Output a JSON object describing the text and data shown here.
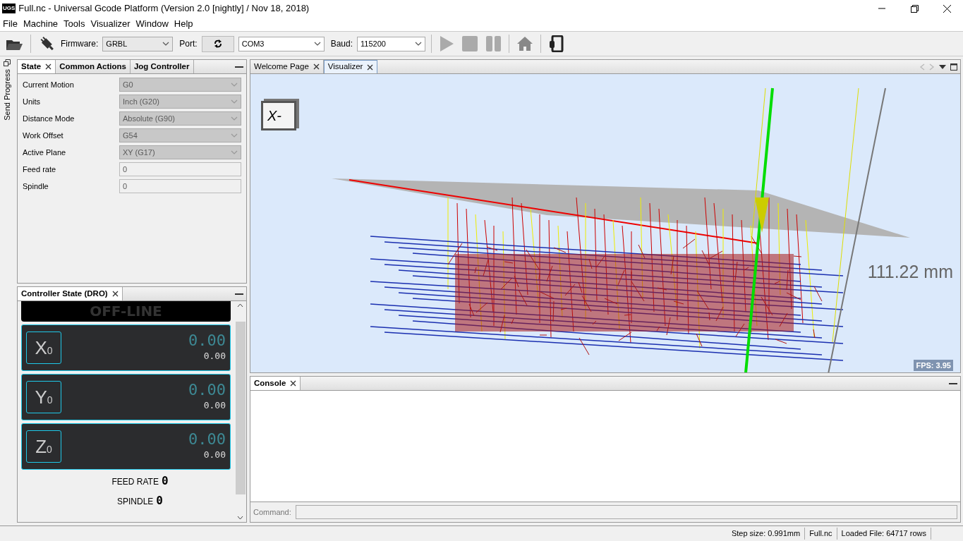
{
  "window": {
    "title": "Full.nc - Universal Gcode Platform (Version 2.0 [nightly]  / Nov 18, 2018)",
    "app_badge": "UGS"
  },
  "menu": [
    "File",
    "Machine",
    "Tools",
    "Visualizer",
    "Window",
    "Help"
  ],
  "toolbar": {
    "firmware_label": "Firmware:",
    "firmware": "GRBL",
    "port_label": "Port:",
    "port": "COM3",
    "baud_label": "Baud:",
    "baud": "115200",
    "run_controls_disabled": true
  },
  "side_strip": {
    "label": "Send Progress"
  },
  "state_panel": {
    "tabs": [
      {
        "label": "State",
        "selected": true,
        "closable": true
      },
      {
        "label": "Common Actions",
        "selected": false,
        "closable": false
      },
      {
        "label": "Jog Controller",
        "selected": false,
        "closable": false
      }
    ],
    "fields": [
      {
        "label": "Current Motion",
        "value": "G0",
        "kind": "select"
      },
      {
        "label": "Units",
        "value": "Inch (G20)",
        "kind": "select"
      },
      {
        "label": "Distance Mode",
        "value": "Absolute (G90)",
        "kind": "select"
      },
      {
        "label": "Work Offset",
        "value": "G54",
        "kind": "select"
      },
      {
        "label": "Active Plane",
        "value": "XY (G17)",
        "kind": "select"
      },
      {
        "label": "Feed rate",
        "value": "0",
        "kind": "text"
      },
      {
        "label": "Spindle",
        "value": "0",
        "kind": "text"
      }
    ]
  },
  "dro_panel": {
    "tabs": [
      {
        "label": "Controller State (DRO)",
        "selected": true,
        "closable": true
      }
    ],
    "status": "OFF-LINE",
    "axes": [
      {
        "label": "X$_{0}$",
        "work": "0.00",
        "machine": "0.00"
      },
      {
        "label": "Y$_{0}$",
        "work": "0.00",
        "machine": "0.00"
      },
      {
        "label": "Z$_{0}$",
        "work": "0.00",
        "machine": "0.00"
      }
    ],
    "readouts": [
      {
        "label": "FEED RATE",
        "value": "0"
      },
      {
        "label": "SPINDLE",
        "value": "0"
      }
    ]
  },
  "editor": {
    "tabs": [
      {
        "label": "Welcome Page",
        "selected": false,
        "closable": true
      },
      {
        "label": "Visualizer",
        "selected": true,
        "closable": true
      }
    ],
    "visualizer": {
      "view_cube": "X-",
      "measurement": "111.22 mm",
      "fps": "FPS: 3.95"
    }
  },
  "console": {
    "tabs": [
      {
        "label": "Console",
        "selected": true,
        "closable": true
      }
    ],
    "command_label": "Command:"
  },
  "status_bar": [
    "Step size: 0.991mm",
    "Full.nc",
    "Loaded File: 64717 rows"
  ]
}
